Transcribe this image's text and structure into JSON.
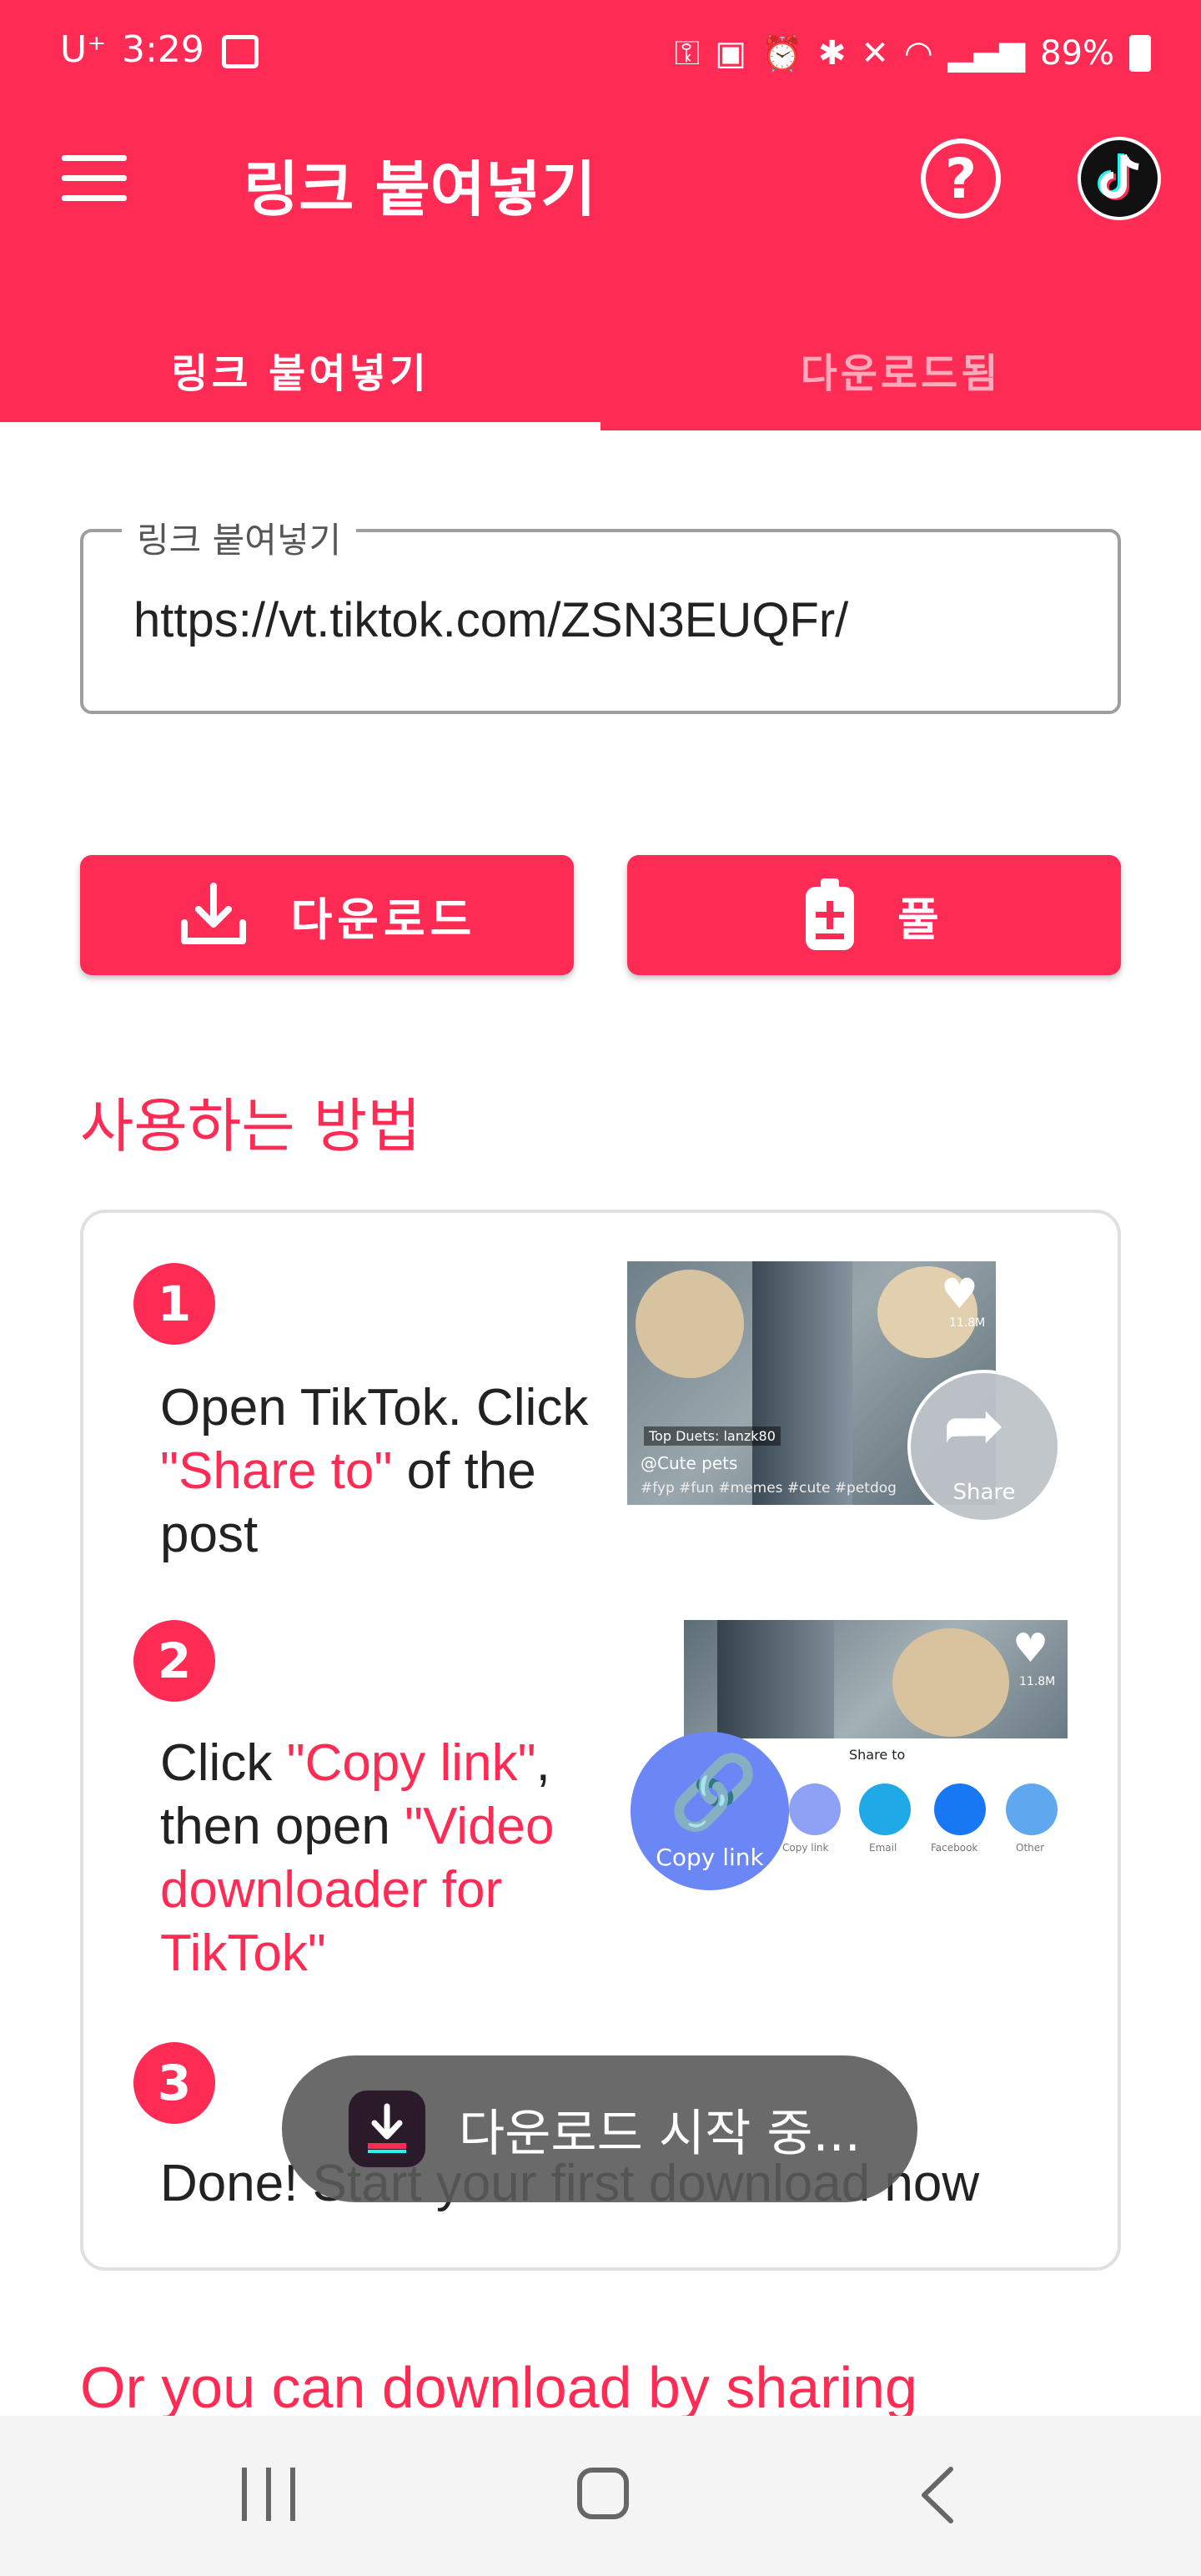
{
  "status_bar": {
    "carrier": "U⁺",
    "time": "3:29",
    "battery": "89%"
  },
  "app_bar": {
    "title": "링크 붙여넣기",
    "icons": [
      "menu-icon",
      "help-icon",
      "tiktok-logo-icon"
    ]
  },
  "tabs": [
    {
      "label": "링크 붙여넣기",
      "active": true
    },
    {
      "label": "다운로드됨",
      "active": false
    }
  ],
  "link_field": {
    "label": "링크 붙여넣기",
    "value": "https://vt.tiktok.com/ZSN3EUQFr/"
  },
  "buttons": {
    "download": "다운로드",
    "paste": "풀"
  },
  "how_to": {
    "title": "사용하는 방법",
    "steps": [
      {
        "number": "1",
        "text_before": "Open TikTok. Click",
        "highlight": "\"Share to\"",
        "text_after": "of the post"
      },
      {
        "number": "2",
        "text_before": "Click",
        "highlight": "\"Copy link\"",
        "text_mid": ", then open",
        "highlight2": "\"Video downloader for TikTok\""
      },
      {
        "number": "3",
        "text": "Done! Start your first download now"
      }
    ],
    "illustration1": {
      "badge": "Top Duets: lanzk80",
      "user": "@Cute pets",
      "hashtags": "#fyp #fun #memes #cute #petdog",
      "likes": "11.8M",
      "share_label": "Share"
    },
    "illustration2": {
      "likes": "11.8M",
      "share_to": "Share to",
      "options": [
        "Copy link",
        "Email",
        "Facebook",
        "Other"
      ],
      "copy_link_label": "Copy link"
    }
  },
  "toast": {
    "text": "다운로드 시작 중..."
  },
  "share_section": {
    "title": "Or you can download by sharing"
  },
  "colors": {
    "accent": "#fe2c55",
    "toast_bg": "#5a5a5a",
    "link_blue": "#6b86f5"
  }
}
